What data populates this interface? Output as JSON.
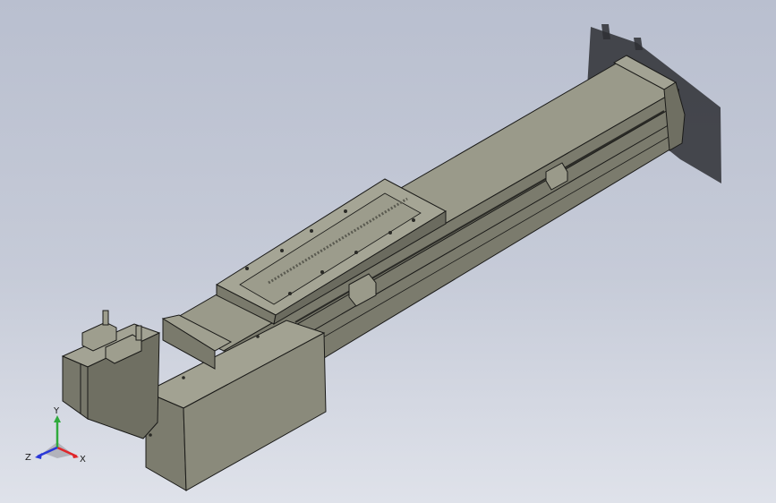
{
  "viewport": {
    "background_top": "#b9bfcf",
    "background_bottom": "#dfe2ea"
  },
  "model": {
    "part_color": "#8e8e7e",
    "part_shadow": "#6d6d60",
    "edge_color": "#1a1a18",
    "background_shadow": "#2e2f34"
  },
  "triad": {
    "x_label": "X",
    "y_label": "Y",
    "z_label": "Z",
    "x_color": "#e0262a",
    "y_color": "#2faa3c",
    "z_color": "#2a38d8"
  }
}
